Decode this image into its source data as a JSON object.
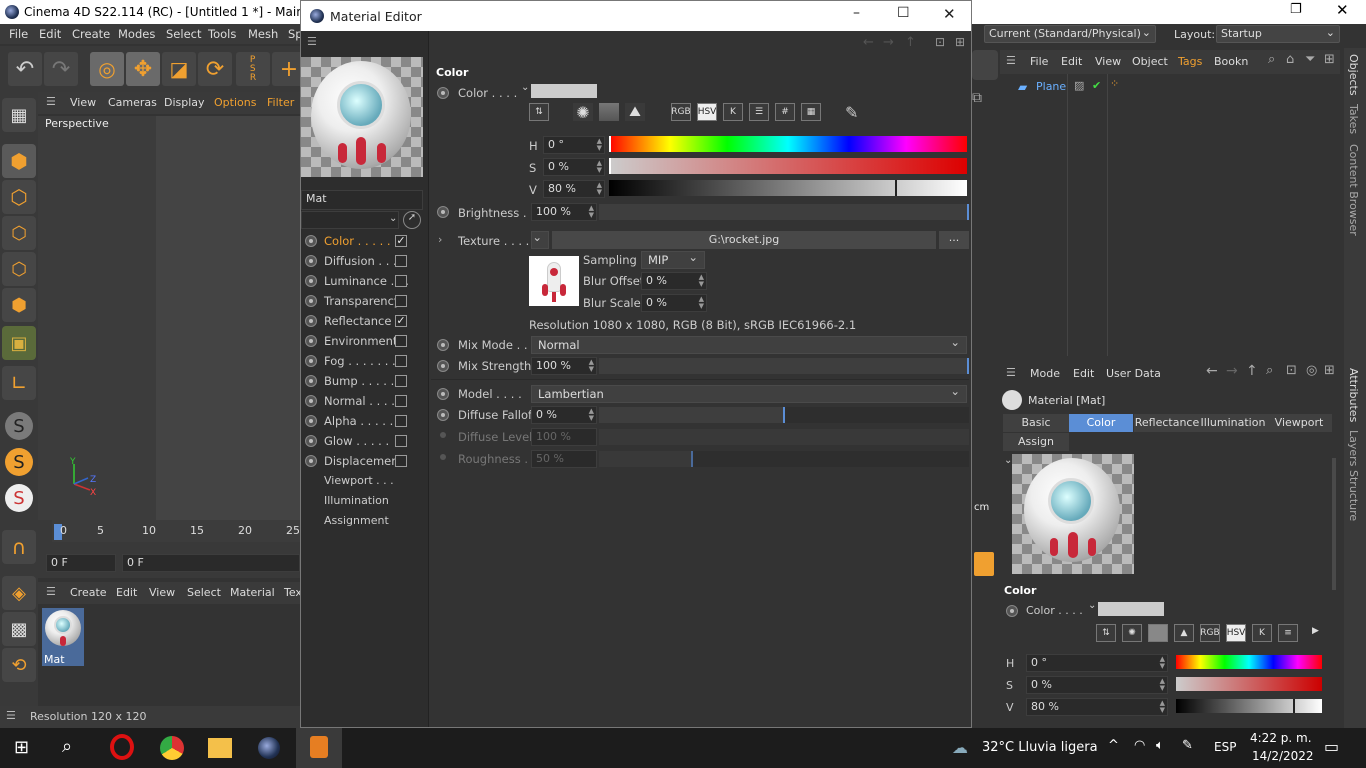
{
  "main_window": {
    "title": "Cinema 4D S22.114 (RC) - [Untitled 1 *] - Main",
    "menu": [
      "File",
      "Edit",
      "Create",
      "Modes",
      "Select",
      "Tools",
      "Mesh",
      "Sp"
    ],
    "viewport_menu": [
      "View",
      "Cameras",
      "Display",
      "Options",
      "Filter"
    ],
    "viewport_label": "Perspective",
    "timeline_ticks": [
      "0",
      "5",
      "10",
      "15",
      "20",
      "25"
    ],
    "frame_current": "0 F",
    "frame_start": "0 F",
    "material_menu": [
      "Create",
      "Edit",
      "View",
      "Select",
      "Material",
      "Tex"
    ],
    "material_name": "Mat",
    "status": "Resolution 120 x 120",
    "cm_label": "cm"
  },
  "layout_bar": {
    "current": "Current (Standard/Physical)",
    "layout_label": "Layout:",
    "layout": "Startup"
  },
  "objects": {
    "menu": [
      "File",
      "Edit",
      "View",
      "Object",
      "Tags",
      "Bookn"
    ],
    "items": [
      {
        "name": "Plane"
      }
    ]
  },
  "right_tabs": [
    "Objects",
    "Takes",
    "Content Browser",
    "Attributes",
    "Layers",
    "Structure"
  ],
  "attributes": {
    "menu": [
      "Mode",
      "Edit",
      "User Data"
    ],
    "title": "Material [Mat]",
    "tabs": [
      "Basic",
      "Color",
      "Reflectance",
      "Illumination",
      "Viewport"
    ],
    "active_tab": "Color",
    "assign": "Assign",
    "section": "Color",
    "color_label": "Color . . . .",
    "h_label": "H",
    "h": "0 °",
    "s_label": "S",
    "s": "0 %",
    "v_label": "V",
    "v": "80 %"
  },
  "material_editor": {
    "title": "Material Editor",
    "name": "Mat",
    "channels": [
      {
        "label": "Color . . . . .",
        "checked": true,
        "active": true
      },
      {
        "label": "Diffusion . . . .",
        "checked": false
      },
      {
        "label": "Luminance . . .",
        "checked": false
      },
      {
        "label": "Transparency",
        "checked": false
      },
      {
        "label": "Reflectance",
        "checked": true
      },
      {
        "label": "Environment",
        "checked": false
      },
      {
        "label": "Fog . . . . . . .",
        "checked": false
      },
      {
        "label": "Bump . . . . .",
        "checked": false
      },
      {
        "label": "Normal . . . .",
        "checked": false
      },
      {
        "label": "Alpha . . . . .",
        "checked": false
      },
      {
        "label": "Glow . . . . .",
        "checked": false
      },
      {
        "label": "Displacement",
        "checked": false
      }
    ],
    "extra": [
      "Viewport . . .",
      "Illumination",
      "Assignment"
    ],
    "section": "Color",
    "color_label": "Color . . . .",
    "mode_buttons": [
      "RGB",
      "HSV",
      "K"
    ],
    "h_label": "H",
    "h": "0 °",
    "s_label": "S",
    "s": "0 %",
    "v_label": "V",
    "v": "80 %",
    "v_level": 0.8,
    "brightness_label": "Brightness . .",
    "brightness": "100 %",
    "texture_label": "Texture . . . .",
    "texture": "G:\\rocket.jpg",
    "browse": "...",
    "sampling_label": "Sampling",
    "sampling": "MIP",
    "blur_offset_label": "Blur Offset",
    "blur_offset": "0 %",
    "blur_scale_label": "Blur Scale",
    "blur_scale": "0 %",
    "resolution": "Resolution 1080 x 1080, RGB (8 Bit), sRGB IEC61966-2.1",
    "mix_mode_label": "Mix Mode . .",
    "mix_mode": "Normal",
    "mix_strength_label": "Mix Strength",
    "mix_strength": "100 %",
    "model_label": "Model . . . .",
    "model": "Lambertian",
    "diffuse_falloff_label": "Diffuse Falloff",
    "diffuse_falloff": "0 %",
    "diffuse_level_label": "Diffuse Level",
    "diffuse_level": "100 %",
    "roughness_label": "Roughness . .",
    "roughness": "50 %"
  },
  "taskbar": {
    "weather": "32°C  Lluvia ligera",
    "lang": "ESP",
    "time": "4:22 p. m.",
    "date": "14/2/2022"
  }
}
